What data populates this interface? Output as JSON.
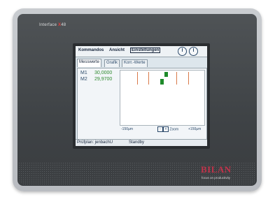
{
  "device": {
    "brand": {
      "prefix": "Interface",
      "accent": "X",
      "suffix": "48"
    },
    "logo": {
      "name": "BILAN",
      "tagline": "focus on productivity"
    }
  },
  "menubar": {
    "items": [
      "Kommandos",
      "Ansicht",
      "Einstellungen"
    ],
    "selected": "Einstellungen"
  },
  "tabs": [
    {
      "label": "Messwerte",
      "active": true
    },
    {
      "label": "Grafik",
      "active": false
    },
    {
      "label": "Korr.-Werte",
      "active": false
    }
  ],
  "measurements": [
    {
      "label": "M1",
      "value": "30,0000"
    },
    {
      "label": "M2",
      "value": "29,9700"
    }
  ],
  "plot": {
    "x_min_label": "-150µm",
    "zoom_label": "Zoom",
    "x_max_label": "+150µm",
    "zoom_minus": "-",
    "zoom_plus": "+"
  },
  "status": {
    "plan_label": "Prüfplan: jenbachU",
    "state": "Standby"
  },
  "colors": {
    "measure_value": "#2f8a2f",
    "marker": "#1e8a2a",
    "tolerance_line": "#d97a4a",
    "accent": "#c0334a"
  }
}
